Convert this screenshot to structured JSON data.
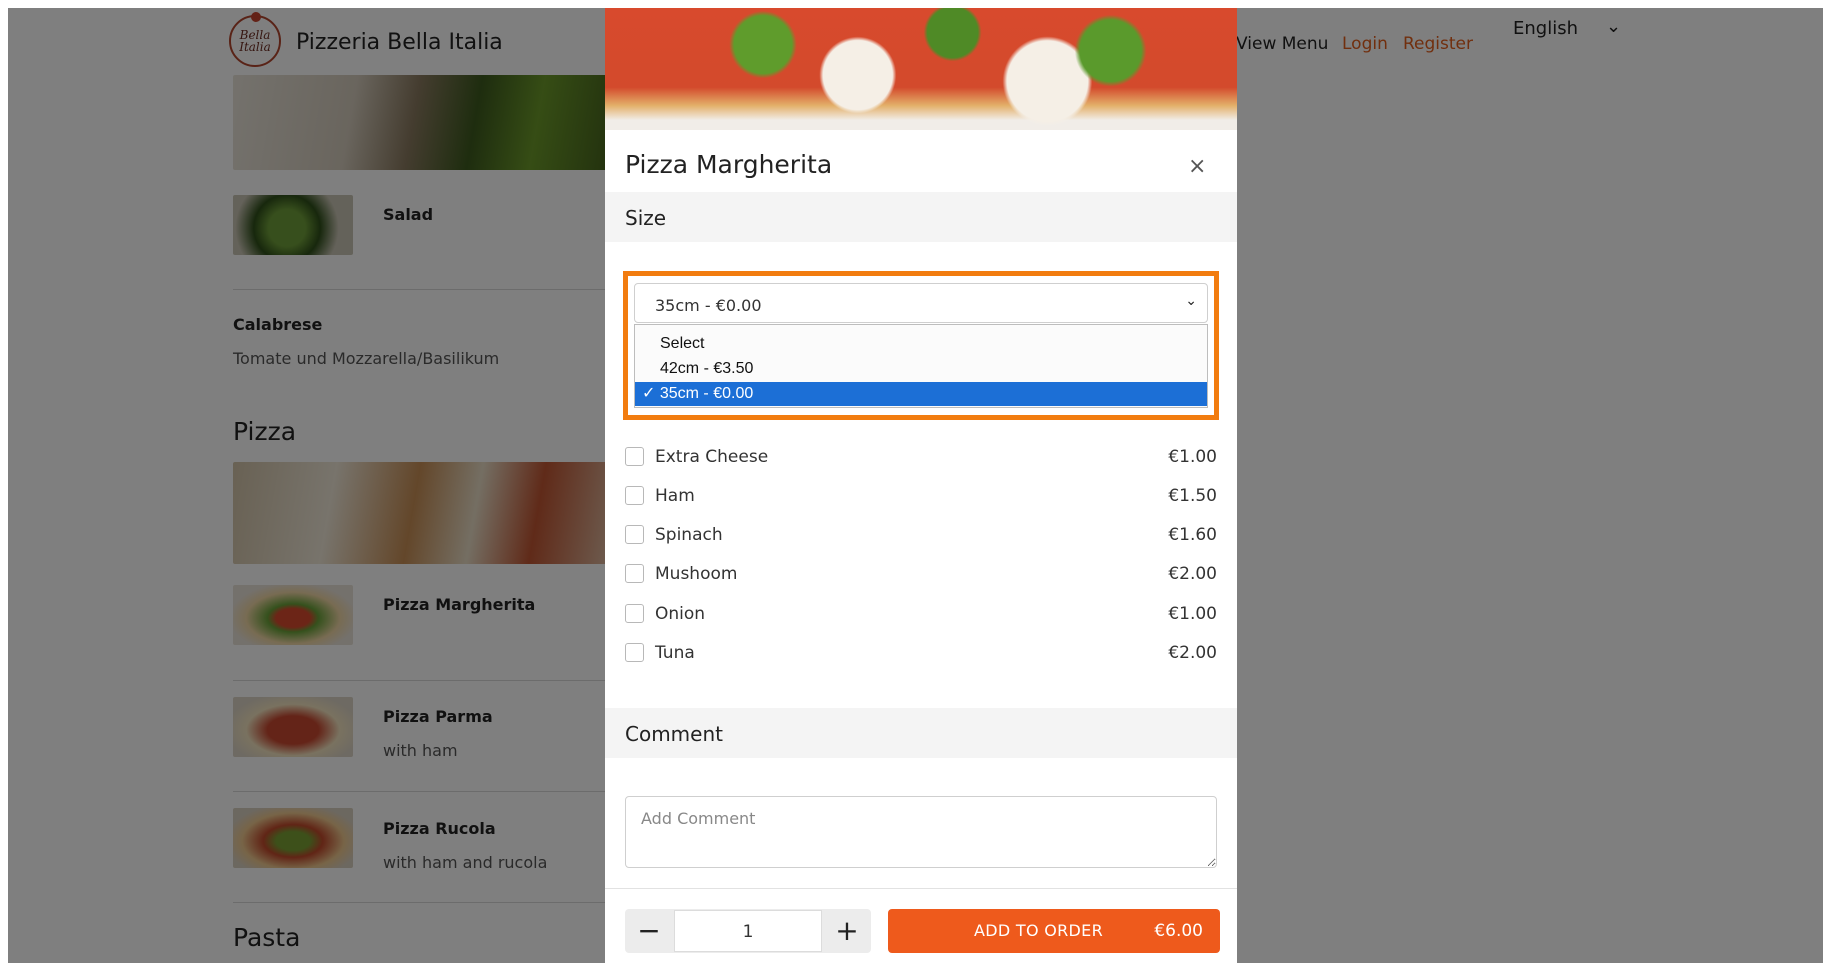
{
  "header": {
    "logo_text": "Bella Italia",
    "brand": "Pizzeria Bella Italia",
    "nav": {
      "view_menu": "View Menu",
      "login": "Login",
      "register": "Register"
    },
    "language": "English"
  },
  "menu": {
    "items_top": [
      {
        "title": "Salad",
        "desc": ""
      },
      {
        "title": "Calabrese",
        "desc": "Tomate und Mozzarella/Basilikum"
      }
    ],
    "sections": [
      {
        "title": "Pizza"
      },
      {
        "title": "Pasta"
      }
    ],
    "pizza_items": [
      {
        "title": "Pizza Margherita",
        "desc": ""
      },
      {
        "title": "Pizza Parma",
        "desc": "with ham"
      },
      {
        "title": "Pizza Rucola",
        "desc": "with ham and rucola"
      }
    ]
  },
  "modal": {
    "title": "Pizza Margherita",
    "close": "×",
    "size_heading": "Size",
    "size_select": {
      "value": "35cm  -  €0.00",
      "options": [
        "Select",
        "42cm  -  €3.50",
        "✓ 35cm  -  €0.00"
      ],
      "selected_index": 2
    },
    "addons": [
      {
        "label": "Extra Cheese",
        "price": "€1.00"
      },
      {
        "label": "Ham",
        "price": "€1.50"
      },
      {
        "label": "Spinach",
        "price": "€1.60"
      },
      {
        "label": "Mushoom",
        "price": "€2.00"
      },
      {
        "label": "Onion",
        "price": "€1.00"
      },
      {
        "label": "Tuna",
        "price": "€2.00"
      }
    ],
    "comment_heading": "Comment",
    "comment_placeholder": "Add Comment",
    "quantity": "1",
    "qty_minus": "−",
    "qty_plus": "+",
    "add_button": {
      "label": "ADD TO ORDER",
      "price": "€6.00"
    }
  },
  "colors": {
    "accent": "#ee5a1c",
    "highlight": "#f27c0f",
    "selected_option": "#1c6fd6"
  }
}
